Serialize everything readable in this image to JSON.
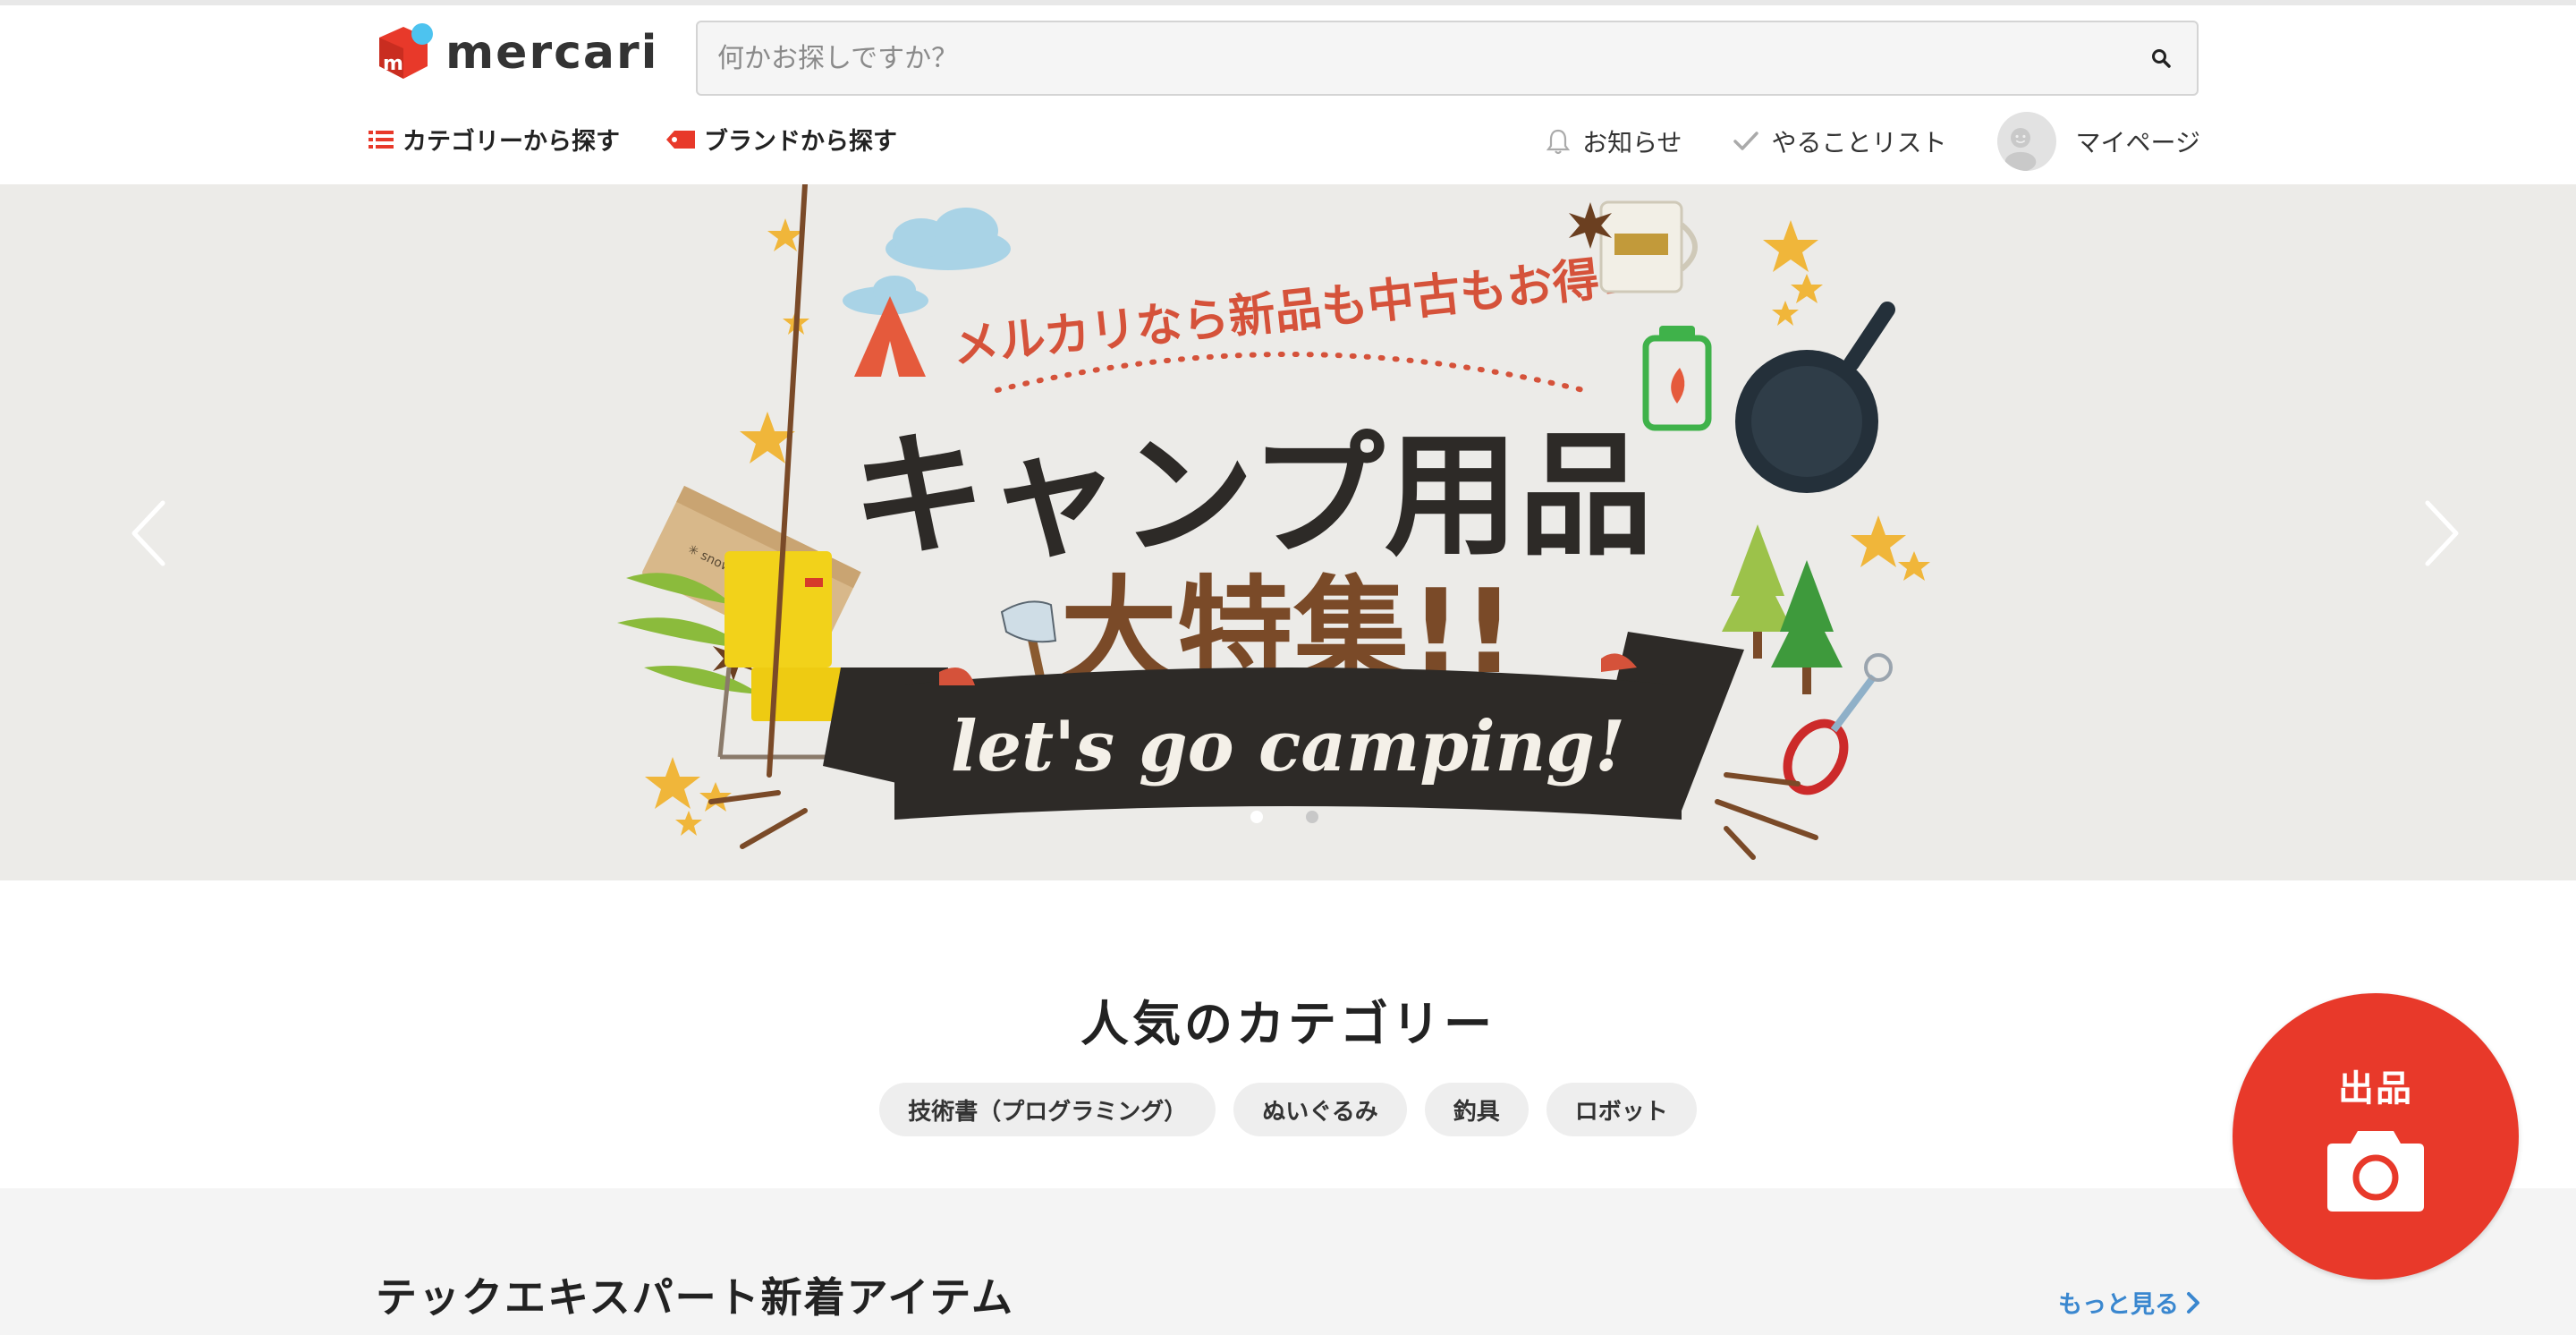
{
  "header": {
    "logo_text": "mercari",
    "search": {
      "placeholder": "何かお探しですか？",
      "value": ""
    },
    "nav_left": [
      {
        "label": "カテゴリーから探す",
        "icon": "list-icon"
      },
      {
        "label": "ブランドから探す",
        "icon": "tag-icon"
      }
    ],
    "nav_right": [
      {
        "label": "お知らせ",
        "icon": "bell-icon"
      },
      {
        "label": "やることリスト",
        "icon": "check-icon"
      },
      {
        "label": "マイページ",
        "icon": "avatar"
      }
    ]
  },
  "banner": {
    "tagline": "メルカリなら新品も中古もお得!",
    "headline_top": "キャンプ用品",
    "headline_bottom": "大特集!!",
    "ribbon_text": "let's go camping!",
    "slide_count": 2,
    "active_slide": 1
  },
  "popular": {
    "title": "人気のカテゴリー",
    "chips": [
      "技術書（プログラミング）",
      "ぬいぐるみ",
      "釣具",
      "ロボット"
    ]
  },
  "new_items": {
    "title": "テックエキスパート新着アイテム",
    "more_label": "もっと見る"
  },
  "fab": {
    "label": "出品",
    "icon": "camera-icon"
  },
  "colors": {
    "brand_red": "#e8392a",
    "link_blue": "#3a87cf",
    "logo_blue": "#4dc3ef"
  }
}
